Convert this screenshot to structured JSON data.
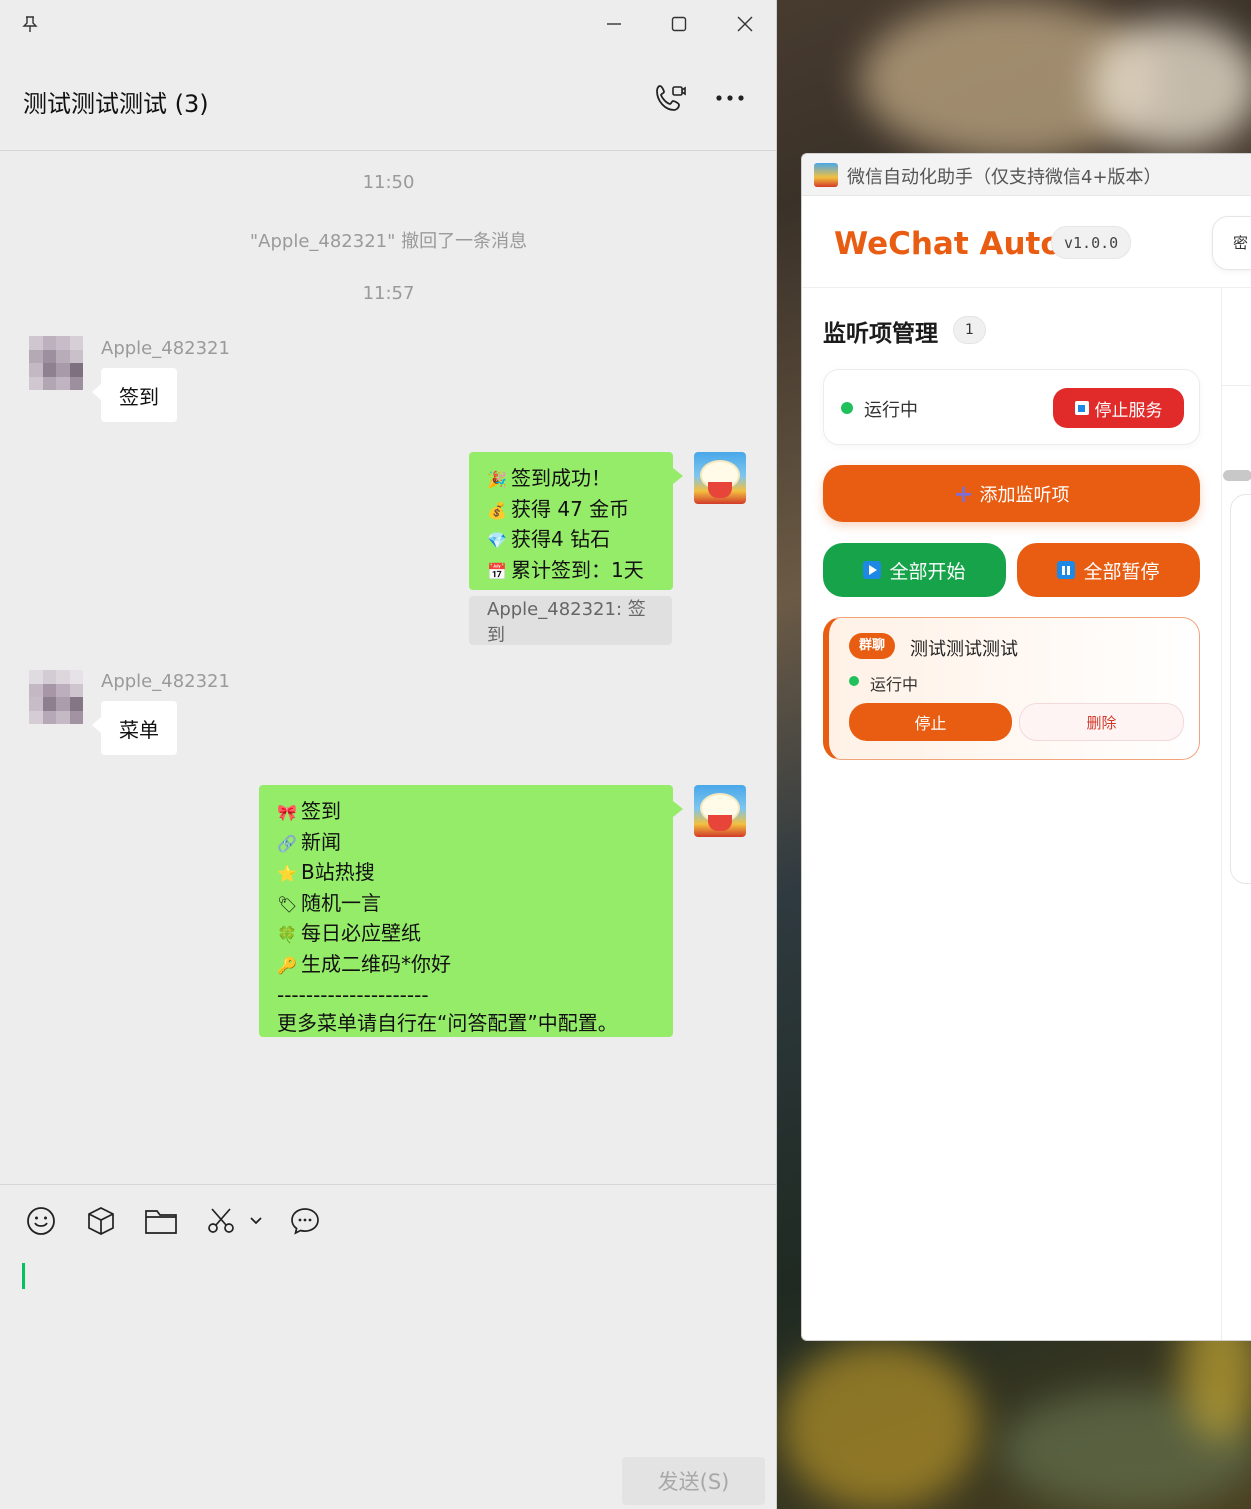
{
  "chat": {
    "title": "测试测试测试 (3)",
    "messages": {
      "time1": "11:50",
      "recall_notice": "\"Apple_482321\" 撤回了一条消息",
      "time2": "11:57",
      "sender1": "Apple_482321",
      "msg1": "签到",
      "reply1_lines": [
        "签到成功！",
        "获得 47 金币",
        "获得4 钻石",
        "累计签到：1天"
      ],
      "reply1_quote": "Apple_482321: 签到",
      "sender2": "Apple_482321",
      "msg2": "菜单",
      "reply2_lines": [
        "签到",
        "新闻",
        "B站热搜",
        "随机一言",
        "每日必应壁纸",
        "生成二维码*你好",
        "---------------------",
        "更多菜单请自行在“问答配置”中配置。"
      ]
    },
    "send_label": "发送(S)",
    "colors": {
      "out_bubble": "#95ec69",
      "caret": "#07c160"
    }
  },
  "app": {
    "window_title": "微信自动化助手（仅支持微信4+版本）",
    "brand": "WeChat Auto",
    "version": "v1.0.0",
    "header_pill_text": "密",
    "section_title": "监听项管理",
    "section_count": "1",
    "service_status": "运行中",
    "stop_service_label": "停止服务",
    "add_label": "添加监听项",
    "start_all_label": "全部开始",
    "pause_all_label": "全部暂停",
    "listener": {
      "tag": "群聊",
      "name": "测试测试测试",
      "status": "运行中",
      "stop_label": "停止",
      "delete_label": "删除"
    },
    "colors": {
      "accent": "#e85d12",
      "danger": "#e12a2a",
      "success": "#17a34a",
      "status_dot": "#20c05c"
    }
  }
}
